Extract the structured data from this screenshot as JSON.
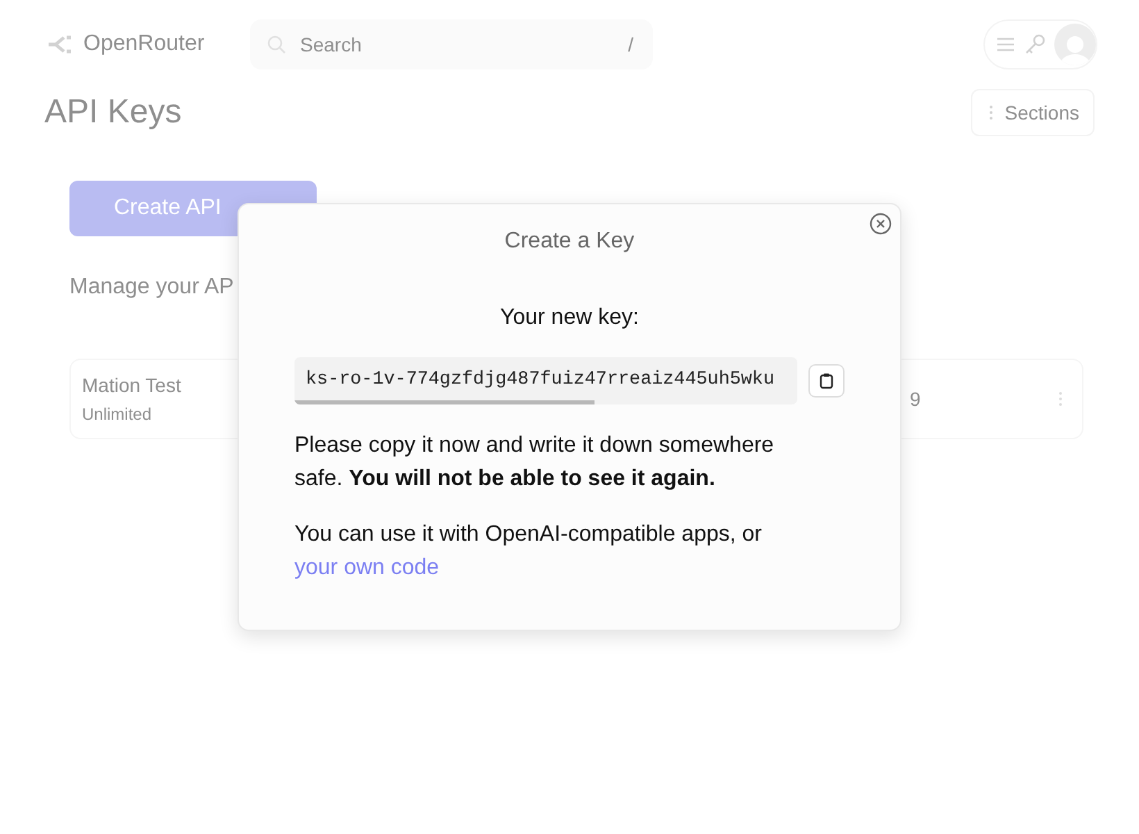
{
  "header": {
    "logo": "OpenRouter",
    "search": {
      "placeholder": "Search",
      "shortcut": "/"
    }
  },
  "page": {
    "title": "API Keys",
    "sections_button": "Sections",
    "create_button": "Create API",
    "description": "Manage your AP",
    "keys": [
      {
        "name": "Mation Test",
        "limit": "Unlimited",
        "column_3": "9"
      }
    ]
  },
  "dialog": {
    "title": "Create a Key",
    "heading": "Your new key:",
    "key": "ks-ro-1v-774gzfdjg487fuiz47rreaiz445uh5wku",
    "warning": "Please copy it now and write it down somewhere safe. **You will not be able to see it again.**",
    "usage": "You can use it with OpenAI-compatible apps, or",
    "link": "your own code"
  }
}
